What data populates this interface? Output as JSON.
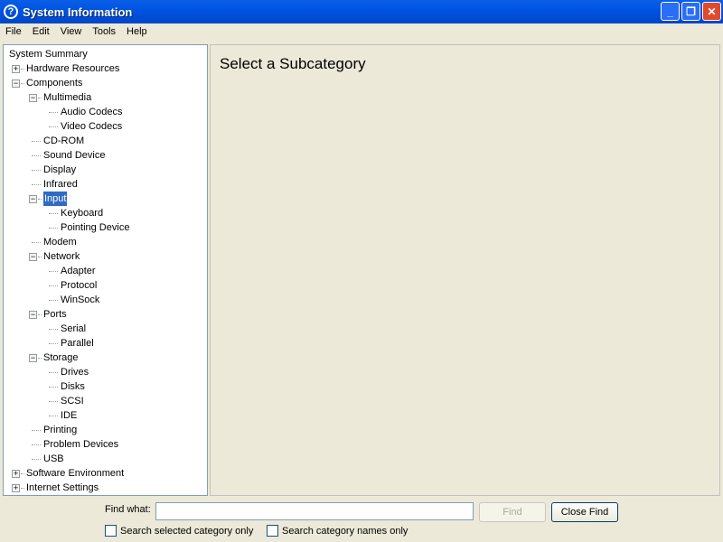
{
  "window": {
    "title": "System Information",
    "icon": "help-icon"
  },
  "menu": [
    "File",
    "Edit",
    "View",
    "Tools",
    "Help"
  ],
  "tree": [
    {
      "label": "System Summary",
      "level": 0,
      "exp": ""
    },
    {
      "label": "Hardware Resources",
      "level": 1,
      "exp": "+"
    },
    {
      "label": "Components",
      "level": 1,
      "exp": "-"
    },
    {
      "label": "Multimedia",
      "level": 2,
      "exp": "-"
    },
    {
      "label": "Audio Codecs",
      "level": 3,
      "exp": ""
    },
    {
      "label": "Video Codecs",
      "level": 3,
      "exp": ""
    },
    {
      "label": "CD-ROM",
      "level": 2,
      "exp": ""
    },
    {
      "label": "Sound Device",
      "level": 2,
      "exp": ""
    },
    {
      "label": "Display",
      "level": 2,
      "exp": ""
    },
    {
      "label": "Infrared",
      "level": 2,
      "exp": ""
    },
    {
      "label": "Input",
      "level": 2,
      "exp": "-",
      "selected": true
    },
    {
      "label": "Keyboard",
      "level": 3,
      "exp": ""
    },
    {
      "label": "Pointing Device",
      "level": 3,
      "exp": ""
    },
    {
      "label": "Modem",
      "level": 2,
      "exp": ""
    },
    {
      "label": "Network",
      "level": 2,
      "exp": "-"
    },
    {
      "label": "Adapter",
      "level": 3,
      "exp": ""
    },
    {
      "label": "Protocol",
      "level": 3,
      "exp": ""
    },
    {
      "label": "WinSock",
      "level": 3,
      "exp": ""
    },
    {
      "label": "Ports",
      "level": 2,
      "exp": "-"
    },
    {
      "label": "Serial",
      "level": 3,
      "exp": ""
    },
    {
      "label": "Parallel",
      "level": 3,
      "exp": ""
    },
    {
      "label": "Storage",
      "level": 2,
      "exp": "-"
    },
    {
      "label": "Drives",
      "level": 3,
      "exp": ""
    },
    {
      "label": "Disks",
      "level": 3,
      "exp": ""
    },
    {
      "label": "SCSI",
      "level": 3,
      "exp": ""
    },
    {
      "label": "IDE",
      "level": 3,
      "exp": ""
    },
    {
      "label": "Printing",
      "level": 2,
      "exp": ""
    },
    {
      "label": "Problem Devices",
      "level": 2,
      "exp": ""
    },
    {
      "label": "USB",
      "level": 2,
      "exp": ""
    },
    {
      "label": "Software Environment",
      "level": 1,
      "exp": "+"
    },
    {
      "label": "Internet Settings",
      "level": 1,
      "exp": "+"
    }
  ],
  "main": {
    "heading": "Select a Subcategory"
  },
  "find": {
    "label": "Find what:",
    "value": "",
    "find_button": "Find",
    "close_button": "Close Find",
    "check1": "Search selected category only",
    "check2": "Search category names only"
  }
}
